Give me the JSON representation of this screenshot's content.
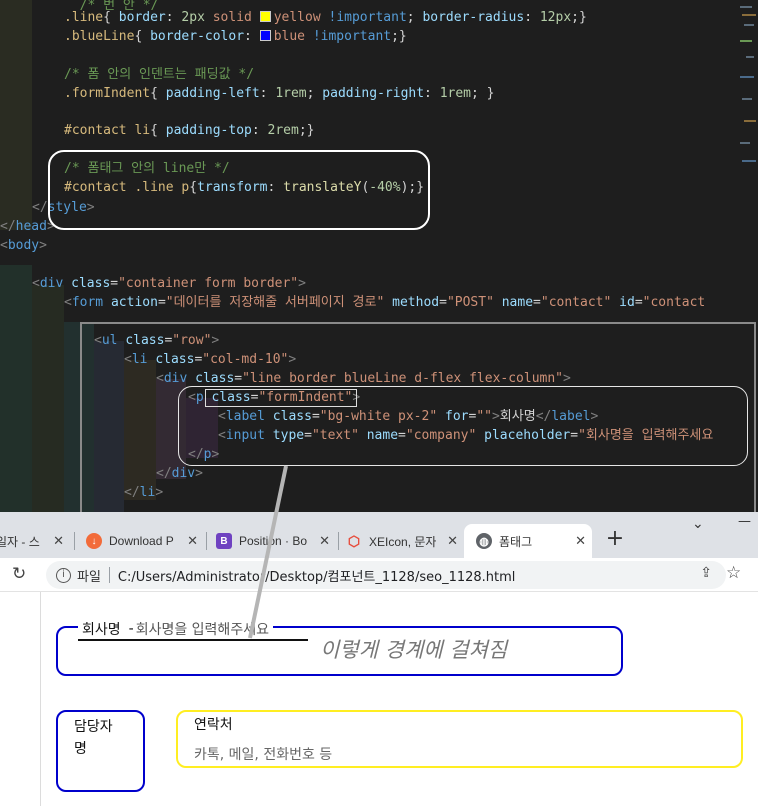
{
  "editor": {
    "lines": [
      [
        [
          "k-com",
          "  /* 번 안 */"
        ]
      ],
      [
        [
          "k-sel",
          ".line"
        ],
        [
          "k-txt",
          "{ "
        ],
        [
          "k-prop",
          "border"
        ],
        [
          "k-txt",
          ": "
        ],
        [
          "k-num",
          "2px"
        ],
        [
          "k-txt",
          " "
        ],
        [
          "k-val",
          "solid"
        ],
        [
          "k-txt",
          " "
        ],
        [
          "swatch",
          "#ffff00"
        ],
        [
          "k-val",
          "yellow"
        ],
        [
          "k-txt",
          " "
        ],
        [
          "k-imp",
          "!important"
        ],
        [
          "k-txt",
          "; "
        ],
        [
          "k-prop",
          "border-radius"
        ],
        [
          "k-txt",
          ": "
        ],
        [
          "k-num",
          "12px"
        ],
        [
          "k-txt",
          ";}"
        ]
      ],
      [
        [
          "k-sel",
          ".blueLine"
        ],
        [
          "k-txt",
          "{ "
        ],
        [
          "k-prop",
          "border-color"
        ],
        [
          "k-txt",
          ": "
        ],
        [
          "swatch",
          "#0000ff"
        ],
        [
          "k-val",
          "blue"
        ],
        [
          "k-txt",
          " "
        ],
        [
          "k-imp",
          "!important"
        ],
        [
          "k-txt",
          ";}"
        ]
      ],
      [],
      [
        [
          "k-com",
          "/* 폼 안의 인덴트는 패딩값 */"
        ]
      ],
      [
        [
          "k-sel",
          ".formIndent"
        ],
        [
          "k-txt",
          "{ "
        ],
        [
          "k-prop",
          "padding-left"
        ],
        [
          "k-txt",
          ": "
        ],
        [
          "k-num",
          "1rem"
        ],
        [
          "k-txt",
          "; "
        ],
        [
          "k-prop",
          "padding-right"
        ],
        [
          "k-txt",
          ": "
        ],
        [
          "k-num",
          "1rem"
        ],
        [
          "k-txt",
          "; }"
        ]
      ],
      [],
      [
        [
          "k-sel",
          "#contact li"
        ],
        [
          "k-txt",
          "{ "
        ],
        [
          "k-prop",
          "padding-top"
        ],
        [
          "k-txt",
          ": "
        ],
        [
          "k-num",
          "2rem"
        ],
        [
          "k-txt",
          ";}"
        ]
      ],
      [],
      [
        [
          "k-com",
          "/* 폼태그 안의 line만 */"
        ]
      ],
      [
        [
          "k-sel",
          "#contact .line p"
        ],
        [
          "k-txt",
          "{"
        ],
        [
          "k-prop",
          "transform"
        ],
        [
          "k-txt",
          ": "
        ],
        [
          "k-fn",
          "translateY"
        ],
        [
          "k-txt",
          "("
        ],
        [
          "k-num",
          "-40%"
        ],
        [
          "k-txt",
          ");}"
        ]
      ],
      [
        [
          "k-br",
          "</"
        ],
        [
          "k-tag",
          "style"
        ],
        [
          "k-br",
          ">"
        ]
      ],
      [
        [
          "k-br",
          "</"
        ],
        [
          "k-tag",
          "head"
        ],
        [
          "k-br",
          ">"
        ]
      ],
      [
        [
          "k-br",
          "<"
        ],
        [
          "k-tag",
          "body"
        ],
        [
          "k-br",
          ">"
        ]
      ],
      [],
      [
        [
          "k-br",
          "<"
        ],
        [
          "k-tag",
          "div"
        ],
        [
          "k-txt",
          " "
        ],
        [
          "k-attr",
          "class"
        ],
        [
          "k-txt",
          "="
        ],
        [
          "k-str",
          "\"container form border\""
        ],
        [
          "k-br",
          ">"
        ]
      ],
      [
        [
          "k-br",
          "<"
        ],
        [
          "k-tag",
          "form"
        ],
        [
          "k-txt",
          " "
        ],
        [
          "k-attr",
          "action"
        ],
        [
          "k-txt",
          "="
        ],
        [
          "k-str",
          "\"데이터를 저장해줄 서버페이지 경로\""
        ],
        [
          "k-txt",
          " "
        ],
        [
          "k-attr",
          "method"
        ],
        [
          "k-txt",
          "="
        ],
        [
          "k-str",
          "\"POST\""
        ],
        [
          "k-txt",
          " "
        ],
        [
          "k-attr",
          "name"
        ],
        [
          "k-txt",
          "="
        ],
        [
          "k-str",
          "\"contact\""
        ],
        [
          "k-txt",
          " "
        ],
        [
          "k-attr",
          "id"
        ],
        [
          "k-txt",
          "="
        ],
        [
          "k-str",
          "\"contact"
        ]
      ],
      [],
      [
        [
          "k-br",
          "<"
        ],
        [
          "k-tag",
          "ul"
        ],
        [
          "k-txt",
          " "
        ],
        [
          "k-attr",
          "class"
        ],
        [
          "k-txt",
          "="
        ],
        [
          "k-str",
          "\"row\""
        ],
        [
          "k-br",
          ">"
        ]
      ],
      [
        [
          "k-br",
          "<"
        ],
        [
          "k-tag",
          "li"
        ],
        [
          "k-txt",
          " "
        ],
        [
          "k-attr",
          "class"
        ],
        [
          "k-txt",
          "="
        ],
        [
          "k-str",
          "\"col-md-10\""
        ],
        [
          "k-br",
          ">"
        ]
      ],
      [
        [
          "k-br",
          "<"
        ],
        [
          "k-tag",
          "div"
        ],
        [
          "k-txt",
          " "
        ],
        [
          "k-attr",
          "class"
        ],
        [
          "k-txt",
          "="
        ],
        [
          "k-str",
          "\"line border blueLine d-flex flex-column\""
        ],
        [
          "k-br",
          ">"
        ]
      ],
      [
        [
          "k-br",
          "<"
        ],
        [
          "k-tag",
          "p"
        ],
        [
          "k-txt",
          " "
        ],
        [
          "k-attr",
          "class"
        ],
        [
          "k-txt",
          "="
        ],
        [
          "k-str",
          "\"formIndent\""
        ],
        [
          "k-br",
          ">"
        ]
      ],
      [
        [
          "k-br",
          "<"
        ],
        [
          "k-tag",
          "label"
        ],
        [
          "k-txt",
          " "
        ],
        [
          "k-attr",
          "class"
        ],
        [
          "k-txt",
          "="
        ],
        [
          "k-str",
          "\"bg-white px-2\""
        ],
        [
          "k-txt",
          " "
        ],
        [
          "k-attr",
          "for"
        ],
        [
          "k-txt",
          "="
        ],
        [
          "k-str",
          "\"\""
        ],
        [
          "k-br",
          ">"
        ],
        [
          "k-txt",
          "회사명"
        ],
        [
          "k-br",
          "</"
        ],
        [
          "k-tag",
          "label"
        ],
        [
          "k-br",
          ">"
        ]
      ],
      [
        [
          "k-br",
          "<"
        ],
        [
          "k-tag",
          "input"
        ],
        [
          "k-txt",
          " "
        ],
        [
          "k-attr",
          "type"
        ],
        [
          "k-txt",
          "="
        ],
        [
          "k-str",
          "\"text\""
        ],
        [
          "k-txt",
          " "
        ],
        [
          "k-attr",
          "name"
        ],
        [
          "k-txt",
          "="
        ],
        [
          "k-str",
          "\"company\""
        ],
        [
          "k-txt",
          " "
        ],
        [
          "k-attr",
          "placeholder"
        ],
        [
          "k-txt",
          "="
        ],
        [
          "k-str",
          "\"회사명을 입력해주세요"
        ]
      ],
      [
        [
          "k-br",
          "</"
        ],
        [
          "k-tag",
          "p"
        ],
        [
          "k-br",
          ">"
        ]
      ],
      [
        [
          "k-br",
          "</"
        ],
        [
          "k-tag",
          "div"
        ],
        [
          "k-br",
          ">"
        ]
      ],
      [
        [
          "k-br",
          "</"
        ],
        [
          "k-tag",
          "li"
        ],
        [
          "k-br",
          ">"
        ]
      ]
    ]
  },
  "browser": {
    "tabs": [
      {
        "title": "일자 - 스",
        "icon": "document-icon",
        "color": "#ffffff"
      },
      {
        "title": "Download P",
        "icon": "download-logo-icon",
        "color": "#f26b3a"
      },
      {
        "title": "Position · Bo",
        "icon": "bootstrap-logo-icon",
        "color": "#6f42c1"
      },
      {
        "title": "XEIcon, 문자",
        "icon": "cube-icon",
        "color": "#e74c3c"
      },
      {
        "title": "폼태그",
        "icon": "globe-icon",
        "color": "#5f6368"
      }
    ],
    "new_tab": "+",
    "window": {
      "minimize": "—",
      "tab_search": "⌄"
    },
    "address": {
      "scheme_label": "파일",
      "url": "C:/Users/Administrator/Desktop/컴포넌트_1128/seo_1128.html"
    }
  },
  "page": {
    "company_label": "회사명",
    "company_dash": "-",
    "company_placeholder": "회사명을 입력해주세요",
    "annotation": "이렇게 경계에 걸쳐짐",
    "manager_label": "담당자명",
    "contact_label": "연락처",
    "contact_placeholder": "카톡, 메일, 전화번호 등"
  },
  "colors": {
    "blue_border": "#0000cc",
    "yellow_border": "#ffee22",
    "annotation_text": "#777777",
    "callout": "#b5b5b5"
  }
}
